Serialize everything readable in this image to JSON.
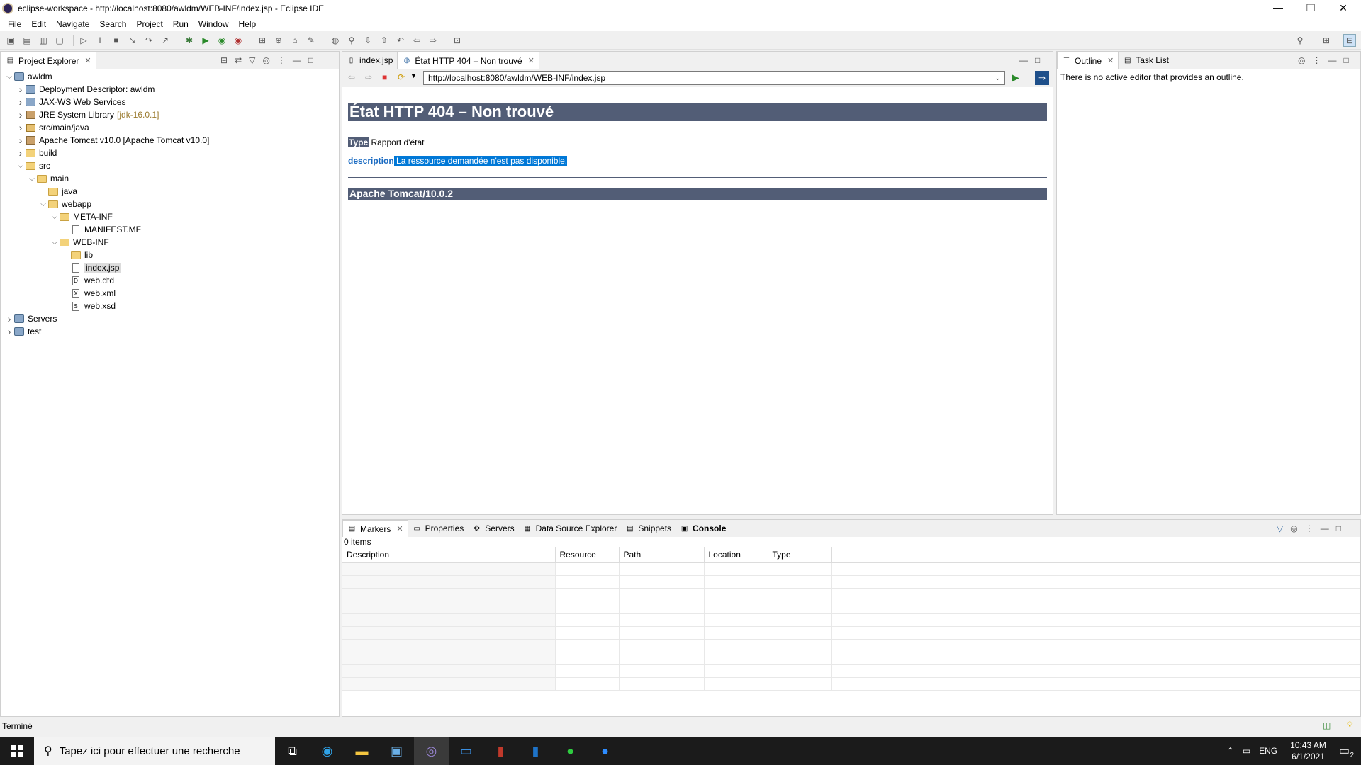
{
  "window": {
    "title": "eclipse-workspace - http://localhost:8080/awldm/WEB-INF/index.jsp - Eclipse IDE"
  },
  "menu": [
    "File",
    "Edit",
    "Navigate",
    "Search",
    "Project",
    "Run",
    "Window",
    "Help"
  ],
  "project_explorer": {
    "tab_label": "Project Explorer",
    "items": [
      {
        "label": "awldm",
        "icon": "project-icon",
        "depth": 0,
        "expanded": true
      },
      {
        "label": "Deployment Descriptor: awldm",
        "icon": "descriptor-icon",
        "depth": 1,
        "expanded": false
      },
      {
        "label": "JAX-WS Web Services",
        "icon": "webservice-icon",
        "depth": 1,
        "expanded": false
      },
      {
        "label": "JRE System Library",
        "suffix": "[jdk-16.0.1]",
        "icon": "library-icon",
        "depth": 1,
        "expanded": false
      },
      {
        "label": "src/main/java",
        "icon": "package-folder-icon",
        "depth": 1,
        "expanded": false
      },
      {
        "label": "Apache Tomcat v10.0 [Apache Tomcat v10.0]",
        "icon": "library-icon",
        "depth": 1,
        "expanded": false
      },
      {
        "label": "build",
        "icon": "folder-icon",
        "depth": 1,
        "expanded": false
      },
      {
        "label": "src",
        "icon": "folder-icon",
        "depth": 1,
        "expanded": true
      },
      {
        "label": "main",
        "icon": "folder-icon",
        "depth": 2,
        "expanded": true
      },
      {
        "label": "java",
        "icon": "folder-icon",
        "depth": 3,
        "leaf": true
      },
      {
        "label": "webapp",
        "icon": "folder-icon",
        "depth": 3,
        "expanded": true
      },
      {
        "label": "META-INF",
        "icon": "folder-icon",
        "depth": 4,
        "expanded": true
      },
      {
        "label": "MANIFEST.MF",
        "icon": "file-icon",
        "depth": 5,
        "leaf": true
      },
      {
        "label": "WEB-INF",
        "icon": "folder-icon",
        "depth": 4,
        "expanded": true
      },
      {
        "label": "lib",
        "icon": "folder-icon",
        "depth": 5,
        "leaf": true
      },
      {
        "label": "index.jsp",
        "icon": "jsp-file-icon",
        "depth": 5,
        "leaf": true,
        "selected": true
      },
      {
        "label": "web.dtd",
        "icon": "dtd-file-icon",
        "depth": 5,
        "leaf": true
      },
      {
        "label": "web.xml",
        "icon": "xml-file-icon",
        "depth": 5,
        "leaf": true
      },
      {
        "label": "web.xsd",
        "icon": "xsd-file-icon",
        "depth": 5,
        "leaf": true
      },
      {
        "label": "Servers",
        "icon": "project-icon",
        "depth": 0,
        "expanded": false
      },
      {
        "label": "test",
        "icon": "project-icon",
        "depth": 0,
        "expanded": false
      }
    ]
  },
  "editor": {
    "tabs": [
      {
        "label": "index.jsp",
        "active": false
      },
      {
        "label": "État HTTP 404 – Non trouvé",
        "active": true
      }
    ],
    "url": "http://localhost:8080/awldm/WEB-INF/index.jsp",
    "page": {
      "heading": "État HTTP 404 – Non trouvé",
      "type_label": "Type",
      "type_value": " Rapport d'état",
      "description_label": "description",
      "description_value": " La ressource demandée n'est pas disponible.",
      "footer": "Apache Tomcat/10.0.2"
    }
  },
  "outline": {
    "tabs": [
      {
        "label": "Outline"
      },
      {
        "label": "Task List"
      }
    ],
    "message": "There is no active editor that provides an outline."
  },
  "bottom": {
    "tabs": [
      {
        "label": "Markers"
      },
      {
        "label": "Properties"
      },
      {
        "label": "Servers"
      },
      {
        "label": "Data Source Explorer"
      },
      {
        "label": "Snippets"
      },
      {
        "label": "Console"
      }
    ],
    "count": "0 items",
    "columns": [
      "Description",
      "Resource",
      "Path",
      "Location",
      "Type"
    ]
  },
  "status": {
    "text": "Terminé"
  },
  "taskbar": {
    "search_placeholder": "Tapez ici pour effectuer une recherche",
    "lang": "ENG",
    "time": "10:43 AM",
    "date": "6/1/2021",
    "notifications": "2"
  }
}
